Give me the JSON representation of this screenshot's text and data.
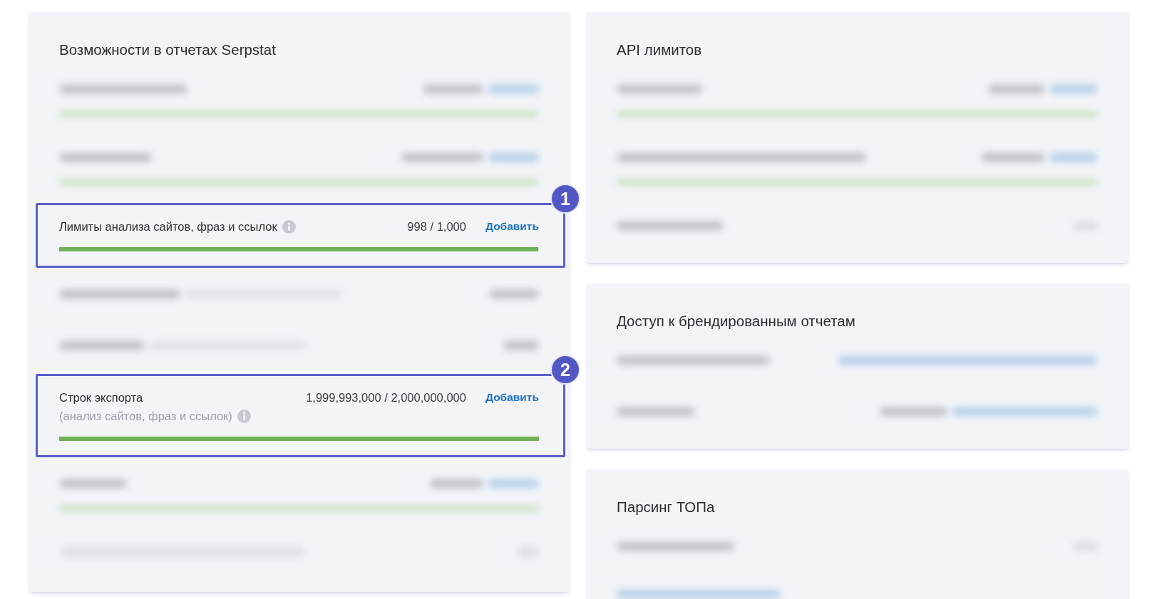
{
  "columns": [
    {
      "cards": [
        {
          "title": "Возможности в отчетах Serpstat",
          "rows": [
            {
              "kind": "blurred_meter"
            },
            {
              "kind": "blurred_meter"
            },
            {
              "kind": "limit",
              "label": "Лимиты анализа сайтов, фраз и ссылок",
              "reading": "998 / 1,000",
              "action": "Добавить",
              "level": 0.998,
              "callout": "1"
            },
            {
              "kind": "blurred_line"
            },
            {
              "kind": "blurred_line"
            },
            {
              "kind": "limit",
              "label": "Строк экспорта",
              "note": "(анализ сайтов, фраз и ссылок)",
              "reading": "1,999,993,000 / 2,000,000,000",
              "action": "Добавить",
              "level": 0.999996,
              "callout": "2"
            },
            {
              "kind": "blurred_meter"
            },
            {
              "kind": "blurred_line"
            }
          ]
        }
      ]
    },
    {
      "cards": [
        {
          "title": "API лимитов",
          "rows": [
            {
              "kind": "blurred_meter"
            },
            {
              "kind": "blurred_meter"
            },
            {
              "kind": "blurred_line"
            }
          ]
        },
        {
          "title": "Доступ к брендированным отчетам",
          "rows": [
            {
              "kind": "blurred_link"
            },
            {
              "kind": "blurred_value_link"
            }
          ]
        },
        {
          "title": "Парсинг ТОПа",
          "rows": [
            {
              "kind": "blurred_line"
            },
            {
              "kind": "blurred_anchor"
            }
          ]
        }
      ]
    }
  ]
}
